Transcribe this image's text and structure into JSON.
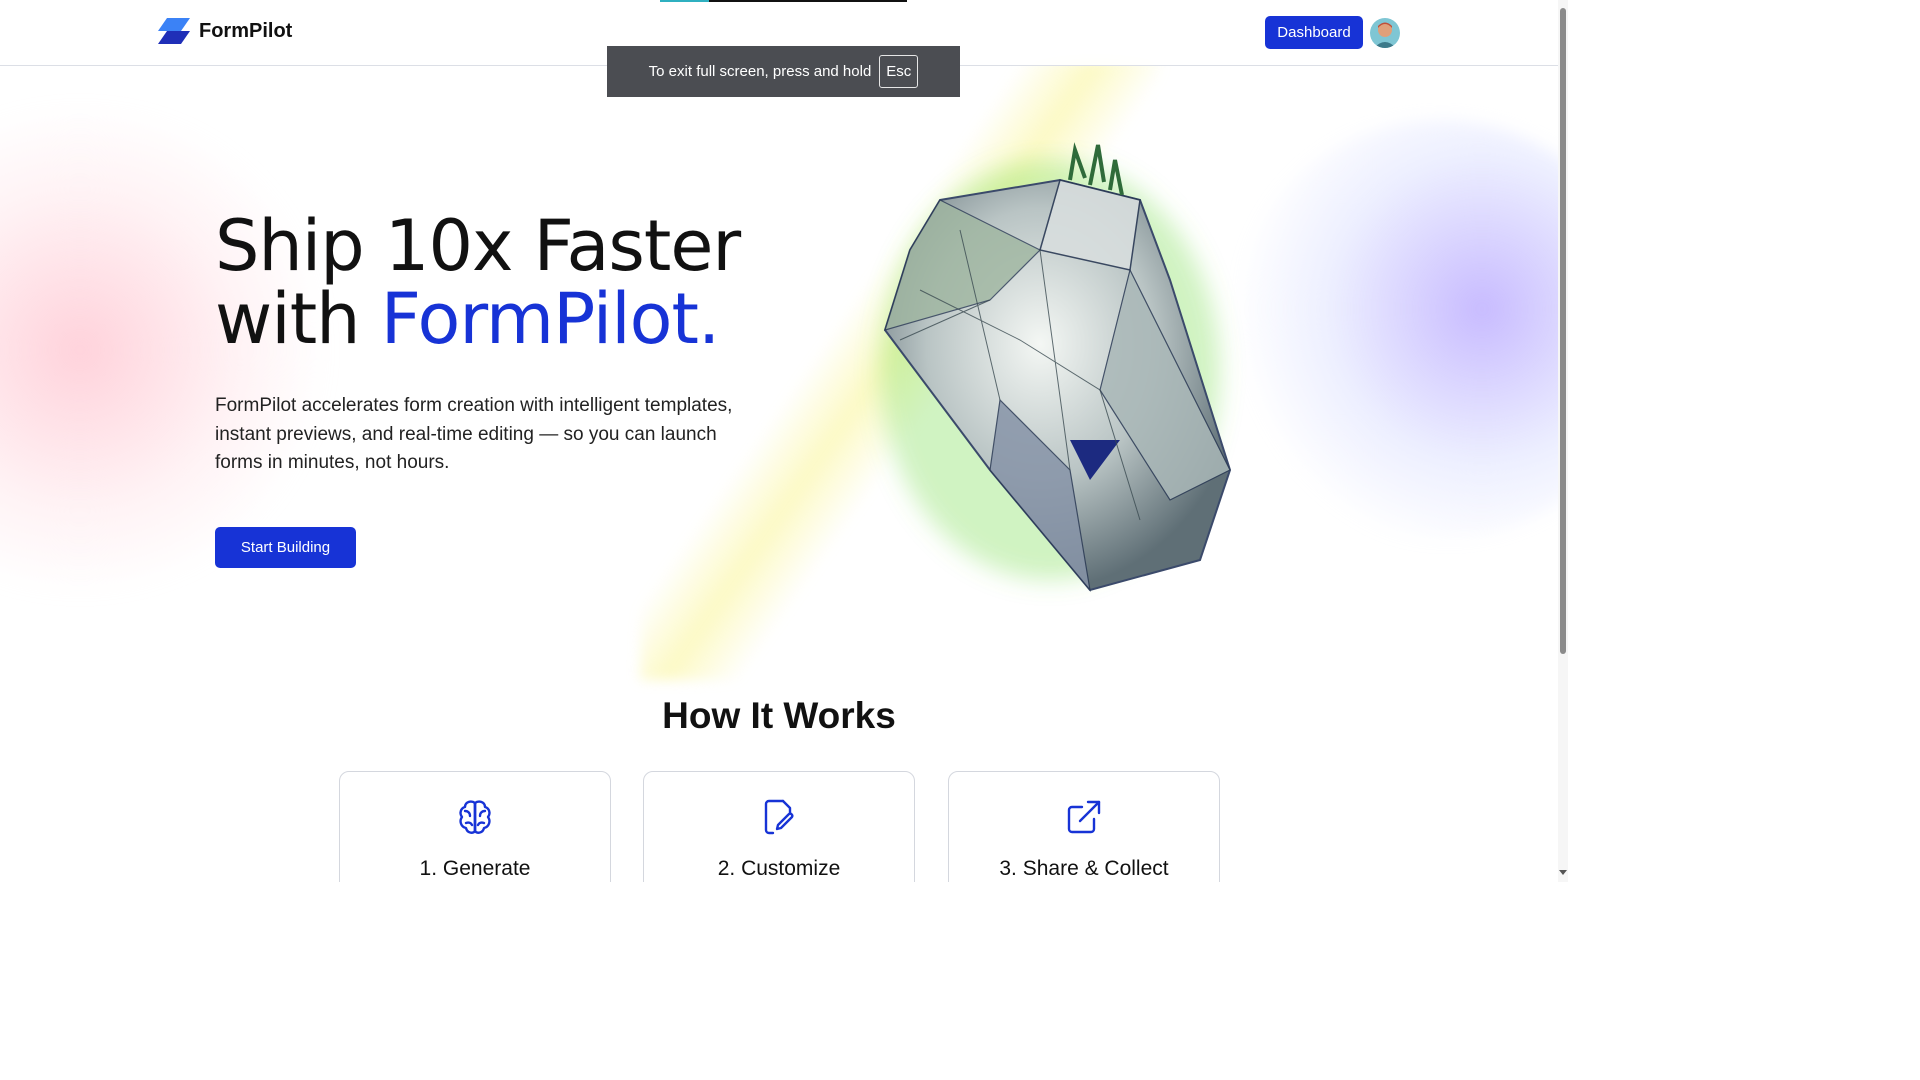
{
  "header": {
    "brand": "FormPilot",
    "dashboard_label": "Dashboard",
    "avatar_icon": "user-avatar"
  },
  "fullscreen_toast": {
    "message": "To exit full screen, press and hold",
    "key": "Esc"
  },
  "hero": {
    "title_line1": "Ship 10x Faster",
    "title_line2_prefix": "with ",
    "title_line2_accent": "FormPilot.",
    "description": "FormPilot accelerates form creation with intelligent templates, instant previews, and real-time editing — so you can launch forms in minutes, not hours.",
    "cta_label": "Start Building"
  },
  "how_it_works": {
    "title": "How It Works",
    "steps": [
      {
        "title": "1. Generate",
        "icon": "brain-icon"
      },
      {
        "title": "2. Customize",
        "icon": "edit-document-icon"
      },
      {
        "title": "3. Share & Collect",
        "icon": "external-link-icon"
      }
    ]
  },
  "colors": {
    "brand": "#1733d6",
    "text": "#111111",
    "toast_bg": "#4b4d52",
    "border": "#d4d7de"
  }
}
